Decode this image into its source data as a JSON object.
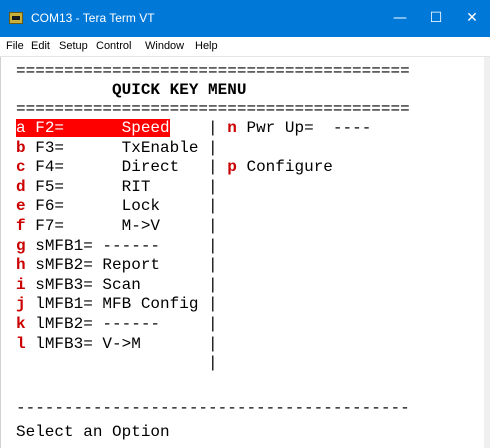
{
  "window": {
    "title": "COM13 - Tera Term VT",
    "minimize_glyph": "—",
    "maximize_glyph": "☐",
    "close_glyph": "✕",
    "icon": "teraterm-app-icon"
  },
  "menu": {
    "items": [
      "File",
      "Edit",
      "Setup",
      "Control",
      "Window",
      "Help"
    ]
  },
  "terminal": {
    "separator_top": "=========================================",
    "menu_title": "QUICK KEY MENU",
    "separator_mid": "=========================================",
    "rows": [
      {
        "key": "a",
        "label": " F2=      Speed",
        "right_key": "n",
        "right_text": " Pwr Up=  ----"
      },
      {
        "key": "b",
        "label": " F3=      TxEnable",
        "right_key": "",
        "right_text": ""
      },
      {
        "key": "c",
        "label": " F4=      Direct",
        "right_key": "p",
        "right_text": " Configure"
      },
      {
        "key": "d",
        "label": " F5=      RIT",
        "right_key": "",
        "right_text": ""
      },
      {
        "key": "e",
        "label": " F6=      Lock",
        "right_key": "",
        "right_text": ""
      },
      {
        "key": "f",
        "label": " F7=      M->V",
        "right_key": "",
        "right_text": ""
      },
      {
        "key": "g",
        "label": " sMFB1= ------",
        "right_key": "",
        "right_text": ""
      },
      {
        "key": "h",
        "label": " sMFB2= Report",
        "right_key": "",
        "right_text": ""
      },
      {
        "key": "i",
        "label": " sMFB3= Scan",
        "right_key": "",
        "right_text": ""
      },
      {
        "key": "j",
        "label": " lMFB1= MFB Config",
        "right_key": "",
        "right_text": ""
      },
      {
        "key": "k",
        "label": " lMFB2= ------",
        "right_key": "",
        "right_text": ""
      },
      {
        "key": "l",
        "label": " lMFB3= V->M",
        "right_key": "",
        "right_text": ""
      },
      {
        "key": "",
        "label": "",
        "right_key": "",
        "right_text": ""
      }
    ],
    "column_divider": "|",
    "separator_bottom": "-----------------------------------------",
    "prompt": "Select an Option",
    "highlight_color": "#ff0000",
    "key_color": "#cc0000"
  }
}
